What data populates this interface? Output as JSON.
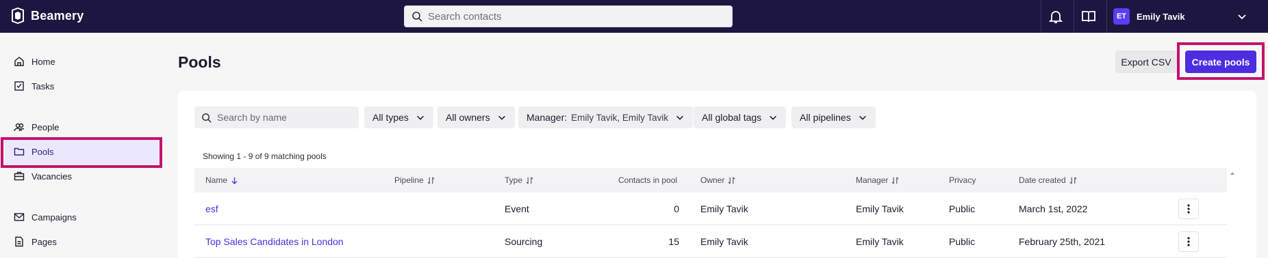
{
  "app": {
    "name": "Beamery"
  },
  "topbar": {
    "search_placeholder": "Search contacts",
    "user": {
      "initials": "ET",
      "name": "Emily Tavik"
    }
  },
  "sidebar": {
    "items": [
      {
        "label": "Home",
        "icon": "home-icon"
      },
      {
        "label": "Tasks",
        "icon": "tasks-icon"
      },
      {
        "label": "People",
        "icon": "people-icon"
      },
      {
        "label": "Pools",
        "icon": "folder-icon",
        "active": true
      },
      {
        "label": "Vacancies",
        "icon": "briefcase-icon"
      },
      {
        "label": "Campaigns",
        "icon": "mail-icon"
      },
      {
        "label": "Pages",
        "icon": "page-icon"
      }
    ]
  },
  "main": {
    "title": "Pools",
    "export_label": "Export CSV",
    "create_label": "Create pools",
    "filters": {
      "search_placeholder": "Search by name",
      "types": "All types",
      "owners": "All owners",
      "manager_label": "Manager:",
      "manager_value": "Emily Tavik, Emily Tavik",
      "global_tags": "All global tags",
      "pipelines": "All pipelines"
    },
    "showing": "Showing 1 - 9 of 9 matching pools",
    "columns": [
      "Name",
      "Pipeline",
      "Type",
      "Contacts in pool",
      "Owner",
      "Manager",
      "Privacy",
      "Date created"
    ],
    "rows": [
      {
        "name": "esf",
        "pipeline": "",
        "type": "Event",
        "contacts": "0",
        "owner": "Emily Tavik",
        "manager": "Emily Tavik",
        "privacy": "Public",
        "date": "March 1st, 2022"
      },
      {
        "name": "Top Sales Candidates in London",
        "pipeline": "",
        "type": "Sourcing",
        "contacts": "15",
        "owner": "Emily Tavik",
        "manager": "Emily Tavik",
        "privacy": "Public",
        "date": "February 25th, 2021"
      }
    ]
  },
  "colors": {
    "topbar": "#1d1640",
    "accent": "#4c2de0",
    "highlight": "#c4126c",
    "active_bg": "#ebe8fb"
  }
}
